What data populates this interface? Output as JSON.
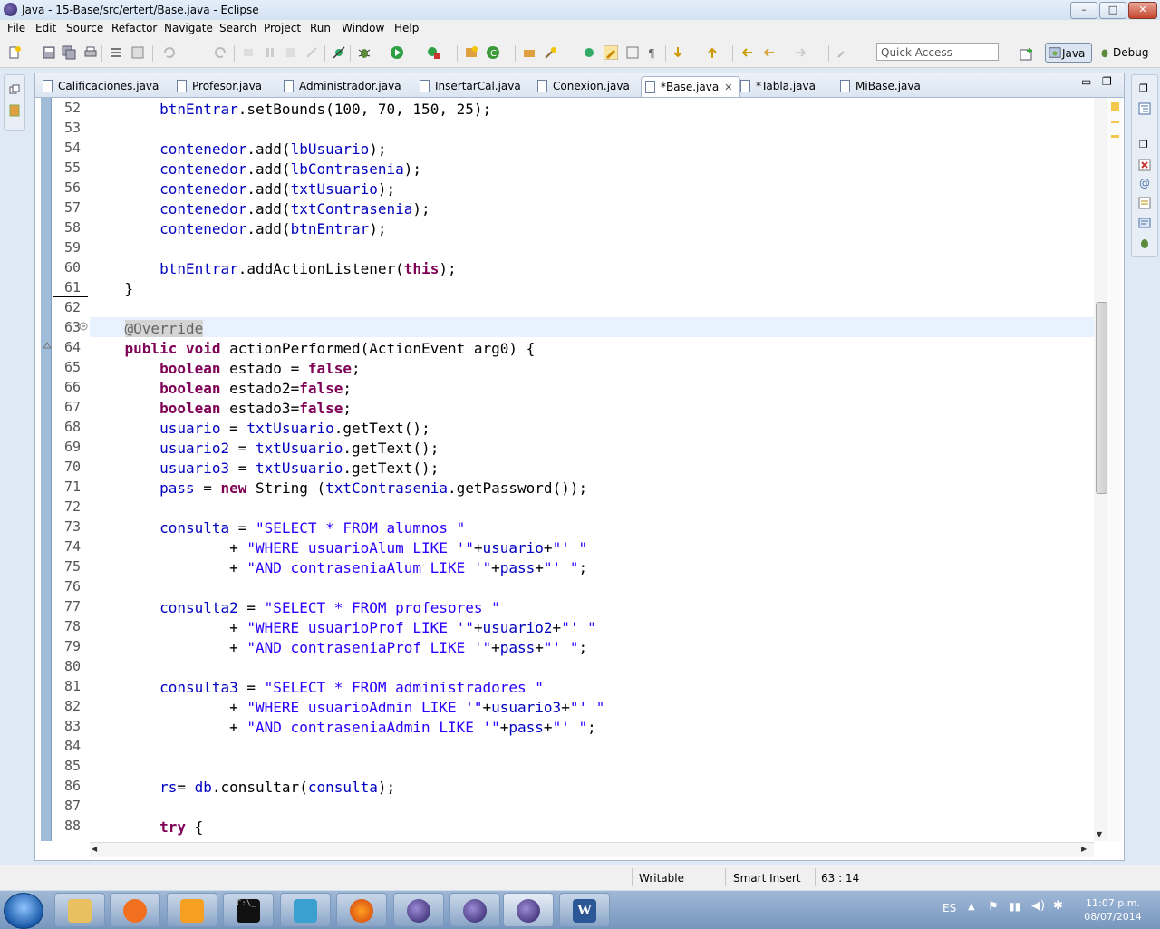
{
  "window": {
    "title": "Java - 15-Base/src/ertert/Base.java - Eclipse",
    "min": "–",
    "max": "□",
    "close": "✕"
  },
  "menu": [
    "File",
    "Edit",
    "Source",
    "Refactor",
    "Navigate",
    "Search",
    "Project",
    "Run",
    "Window",
    "Help"
  ],
  "toolbar": {
    "quick_access_placeholder": "Quick Access",
    "perspective_java": "Java",
    "perspective_debug": "Debug"
  },
  "tabs": [
    {
      "label": "Calificaciones.java",
      "active": false
    },
    {
      "label": "Profesor.java",
      "active": false
    },
    {
      "label": "Administrador.java",
      "active": false
    },
    {
      "label": "InsertarCal.java",
      "active": false
    },
    {
      "label": "Conexion.java",
      "active": false
    },
    {
      "label": "*Base.java",
      "active": true
    },
    {
      "label": "*Tabla.java",
      "active": false
    },
    {
      "label": "MiBase.java",
      "active": false
    }
  ],
  "editor": {
    "current_line": 63,
    "lines": [
      {
        "n": "52",
        "text": "        btnEntrar.setBounds(100, 70, 150, 25);"
      },
      {
        "n": "53",
        "text": ""
      },
      {
        "n": "54",
        "text": "        contenedor.add(lbUsuario);"
      },
      {
        "n": "55",
        "text": "        contenedor.add(lbContrasenia);"
      },
      {
        "n": "56",
        "text": "        contenedor.add(txtUsuario);"
      },
      {
        "n": "57",
        "text": "        contenedor.add(txtContrasenia);"
      },
      {
        "n": "58",
        "text": "        contenedor.add(btnEntrar);"
      },
      {
        "n": "59",
        "text": ""
      },
      {
        "n": "60",
        "text": "        btnEntrar.addActionListener(this);"
      },
      {
        "n": "61",
        "text": "    }"
      },
      {
        "n": "62",
        "text": ""
      },
      {
        "n": "63",
        "text": "    @Override"
      },
      {
        "n": "64",
        "text": "    public void actionPerformed(ActionEvent arg0) {"
      },
      {
        "n": "65",
        "text": "        boolean estado = false;"
      },
      {
        "n": "66",
        "text": "        boolean estado2=false;"
      },
      {
        "n": "67",
        "text": "        boolean estado3=false;"
      },
      {
        "n": "68",
        "text": "        usuario = txtUsuario.getText();"
      },
      {
        "n": "69",
        "text": "        usuario2 = txtUsuario.getText();"
      },
      {
        "n": "70",
        "text": "        usuario3 = txtUsuario.getText();"
      },
      {
        "n": "71",
        "text": "        pass = new String (txtContrasenia.getPassword());"
      },
      {
        "n": "72",
        "text": ""
      },
      {
        "n": "73",
        "text": "        consulta = \"SELECT * FROM alumnos \""
      },
      {
        "n": "74",
        "text": "                + \"WHERE usuarioAlum LIKE '\"+usuario+\"' \""
      },
      {
        "n": "75",
        "text": "                + \"AND contraseniaAlum LIKE '\"+pass+\"' \";"
      },
      {
        "n": "76",
        "text": ""
      },
      {
        "n": "77",
        "text": "        consulta2 = \"SELECT * FROM profesores \""
      },
      {
        "n": "78",
        "text": "                + \"WHERE usuarioProf LIKE '\"+usuario2+\"' \""
      },
      {
        "n": "79",
        "text": "                + \"AND contraseniaProf LIKE '\"+pass+\"' \";"
      },
      {
        "n": "80",
        "text": ""
      },
      {
        "n": "81",
        "text": "        consulta3 = \"SELECT * FROM administradores \""
      },
      {
        "n": "82",
        "text": "                + \"WHERE usuarioAdmin LIKE '\"+usuario3+\"' \""
      },
      {
        "n": "83",
        "text": "                + \"AND contraseniaAdmin LIKE '\"+pass+\"' \";"
      },
      {
        "n": "84",
        "text": ""
      },
      {
        "n": "85",
        "text": ""
      },
      {
        "n": "86",
        "text": "        rs= db.consultar(consulta);"
      },
      {
        "n": "87",
        "text": ""
      },
      {
        "n": "88",
        "text": "        try {"
      }
    ]
  },
  "status": {
    "mode": "Writable",
    "insert": "Smart Insert",
    "position": "63 : 14"
  },
  "taskbar": {
    "lang": "ES",
    "time": "11:07 p.m.",
    "date": "08/07/2014"
  }
}
